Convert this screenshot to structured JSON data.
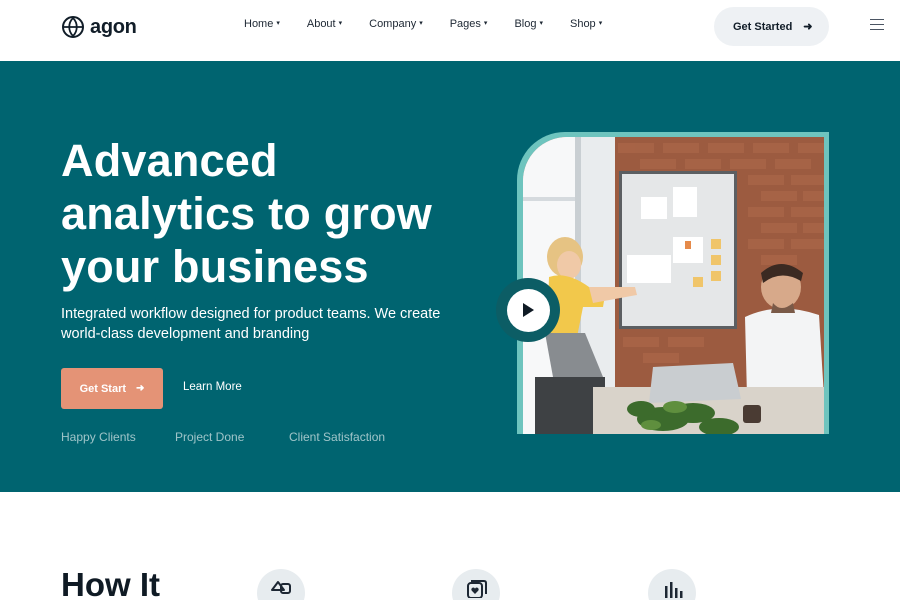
{
  "header": {
    "brand": "agon",
    "nav": [
      {
        "label": "Home",
        "caret": "▾"
      },
      {
        "label": "About",
        "caret": "▾"
      },
      {
        "label": "Company",
        "caret": "▾"
      },
      {
        "label": "Pages",
        "caret": "▾"
      },
      {
        "label": "Blog",
        "caret": "▾"
      },
      {
        "label": "Shop",
        "caret": "▾"
      }
    ],
    "cta_label": "Get Started",
    "cta_arrow": "➜"
  },
  "hero": {
    "title_lines": [
      "Advanced",
      "analytics to grow",
      "your business"
    ],
    "subtitle": "Integrated workflow designed for product teams. We create world-class development and branding",
    "primary_label": "Get Start",
    "primary_arrow": "➜",
    "secondary_label": "Learn More",
    "stats": [
      "Happy Clients",
      "Project Done",
      "Client Satisfaction"
    ]
  },
  "how": {
    "title": "How It"
  },
  "icons": {
    "logo": "agon-logo-icon",
    "menu": "hamburger-menu-icon",
    "play": "play-icon",
    "features": [
      "shapes-icon",
      "shield-heart-icon",
      "bar-chart-icon"
    ]
  },
  "colors": {
    "hero_bg": "#006470",
    "accent": "#e49376",
    "frame": "#6ec4be",
    "text_dark": "#0f1a24"
  }
}
